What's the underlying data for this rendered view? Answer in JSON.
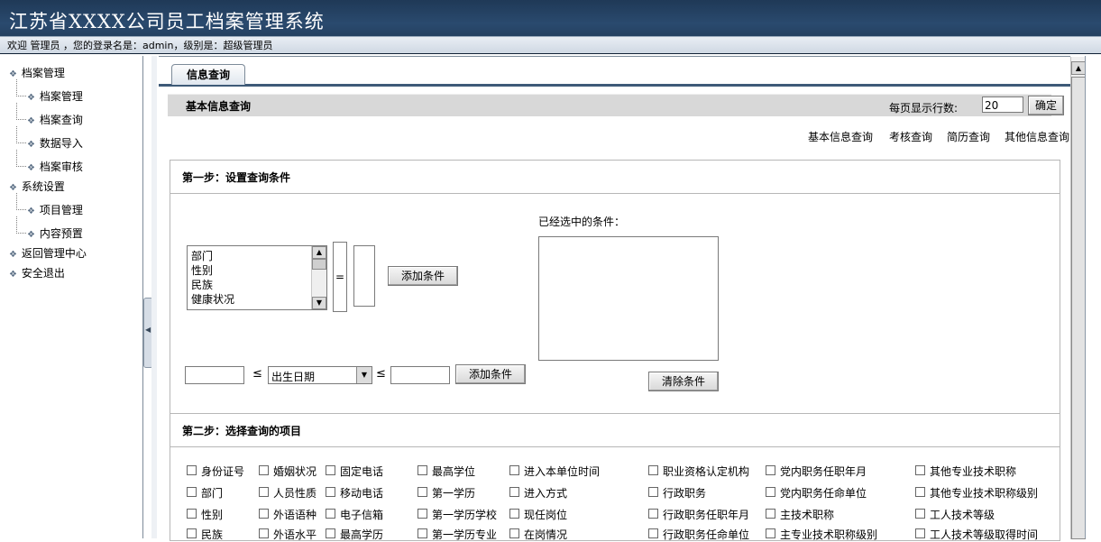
{
  "header": {
    "app_title": "江苏省XXXX公司员工档案管理系统",
    "welcome": "欢迎 管理员 ，您的登录名是：admin，级别是：超级管理员"
  },
  "sidebar": {
    "items": [
      {
        "label": "档案管理",
        "level": 0
      },
      {
        "label": "档案管理",
        "level": 1
      },
      {
        "label": "档案查询",
        "level": 1
      },
      {
        "label": "数据导入",
        "level": 1
      },
      {
        "label": "档案审核",
        "level": 1
      },
      {
        "label": "系统设置",
        "level": 0
      },
      {
        "label": "项目管理",
        "level": 1
      },
      {
        "label": "内容预置",
        "level": 1
      },
      {
        "label": "返回管理中心",
        "level": 0
      },
      {
        "label": "安全退出",
        "level": 0
      }
    ]
  },
  "tab": {
    "label": "信息查询"
  },
  "info_bar": {
    "title": "基本信息查询",
    "rows_label": "每页显示行数:",
    "rows_value": "20",
    "confirm_label": "确定"
  },
  "query_links": [
    "基本信息查询",
    "考核查询",
    "简历查询",
    "其他信息查询"
  ],
  "step1": {
    "title": "第一步：设置查询条件",
    "field_options": [
      "部门",
      "性别",
      "民族",
      "健康状况"
    ],
    "eq_symbol": "=",
    "add_condition_label": "添加条件",
    "selected_label": "已经选中的条件：",
    "clear_label": "清除条件",
    "le_symbol": "≤",
    "date_select_value": "出生日期",
    "add_condition2_label": "添加条件"
  },
  "step2": {
    "title": "第二步：选择查询的项目",
    "columns": [
      [
        "身份证号",
        "部门",
        "性别",
        "民族"
      ],
      [
        "婚姻状况",
        "人员性质",
        "外语语种",
        "外语水平"
      ],
      [
        "固定电话",
        "移动电话",
        "电子信箱",
        "最高学历"
      ],
      [
        "最高学位",
        "第一学历",
        "第一学历学校",
        "第一学历专业"
      ],
      [
        "进入本单位时间",
        "进入方式",
        "现任岗位",
        "在岗情况"
      ],
      [
        "职业资格认定机构",
        "行政职务",
        "行政职务任职年月",
        "行政职务任命单位"
      ],
      [
        "党内职务任职年月",
        "党内职务任命单位",
        "主技术职称",
        "主专业技术职称级别"
      ],
      [
        "其他专业技术职称",
        "其他专业技术职称级别",
        "工人技术等级",
        "工人技术等级取得时间"
      ]
    ]
  },
  "colors": {
    "header_bg": "#24426a",
    "accent": "#3e5a78"
  }
}
